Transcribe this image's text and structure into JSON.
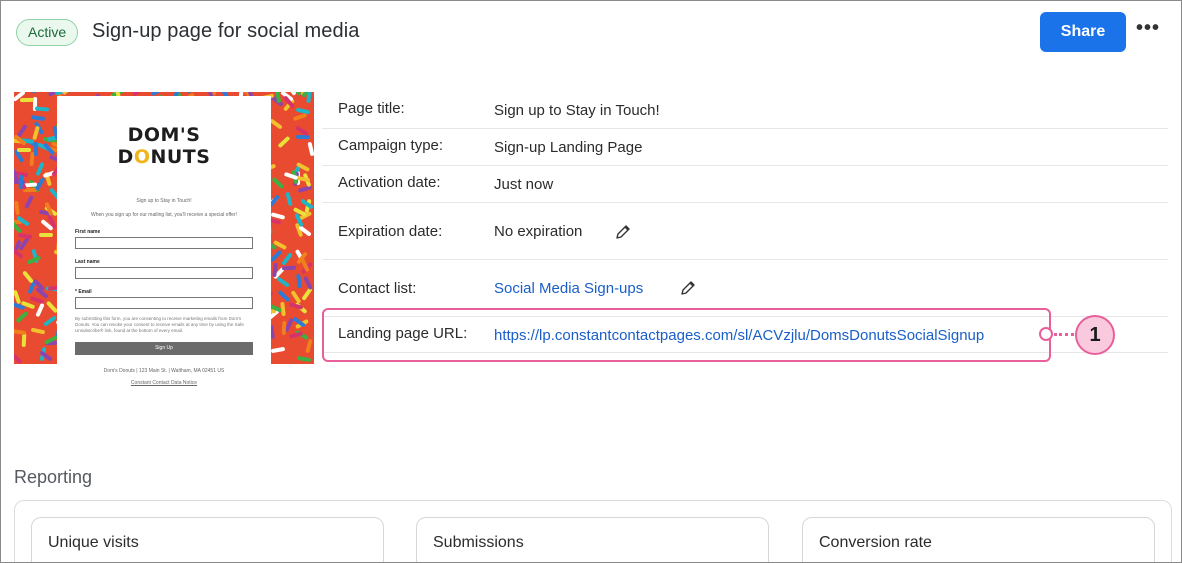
{
  "header": {
    "status_badge": "Active",
    "title": "Sign-up page for social media",
    "share_label": "Share",
    "more_icon": "ellipsis-icon"
  },
  "preview": {
    "logo_line1_a": "DOM'S",
    "logo_line2_a": "D",
    "logo_line2_o": "O",
    "logo_line2_b": "NUTS",
    "heading": "Sign up to Stay in Touch!",
    "subheading": "When you sign up for our mailing list, you'll receive a special offer!",
    "fields": [
      "First name",
      "Last name",
      "* Email"
    ],
    "fine_print": "By submitting this form, you are consenting to receive marketing emails from Dom's Donuts. You can revoke your consent to receive emails at any time by using the Safe Unsubscribe® link, found at the bottom of every email.",
    "button_label": "Sign Up",
    "footer_address": "Dom's Donuts | 123 Main St. | Waltham, MA 02451 US",
    "footer_link": "Constant Contact Data Notice"
  },
  "details": {
    "page_title_label": "Page title:",
    "page_title_value": "Sign up to Stay in Touch!",
    "campaign_type_label": "Campaign type:",
    "campaign_type_value": "Sign-up Landing Page",
    "activation_label": "Activation date:",
    "activation_value": "Just now",
    "expiration_label": "Expiration date:",
    "expiration_value": "No expiration",
    "contact_list_label": "Contact list:",
    "contact_list_value": "Social Media Sign-ups",
    "url_label": "Landing page URL:",
    "url_value": "https://lp.constantcontactpages.com/sl/ACVzjlu/DomsDonutsSocialSignup"
  },
  "callout": {
    "number": "1"
  },
  "reporting": {
    "title": "Reporting",
    "cards": [
      "Unique visits",
      "Submissions",
      "Conversion rate"
    ]
  },
  "colors": {
    "primary": "#1a73e8",
    "link": "#1a5fc9",
    "active_green": "#1d6b3a",
    "highlight_pink": "#e8609a"
  }
}
